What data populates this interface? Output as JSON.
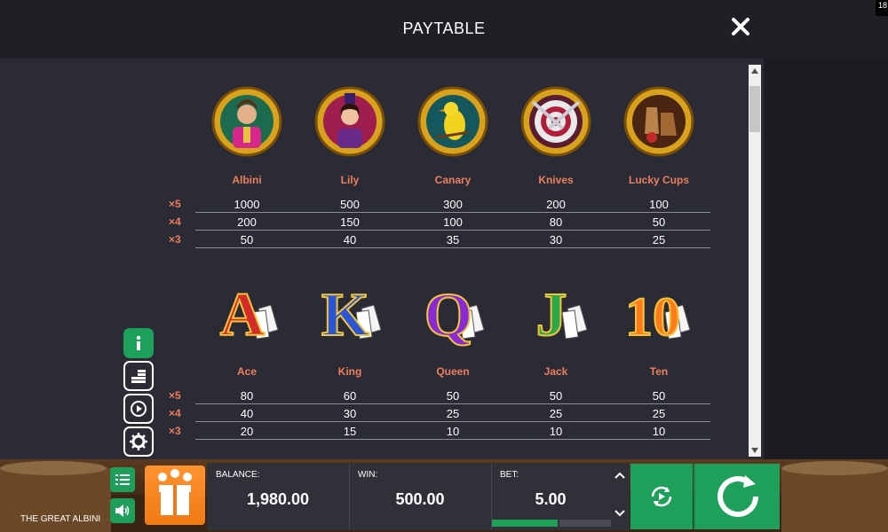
{
  "header": {
    "title": "PAYTABLE",
    "corner_badge": "18"
  },
  "symbols_top": {
    "names": [
      "Albini",
      "Lily",
      "Canary",
      "Knives",
      "Lucky Cups"
    ],
    "icons": [
      "magician-portrait-icon",
      "lady-portrait-icon",
      "canary-bird-icon",
      "knife-target-icon",
      "lucky-cups-icon"
    ],
    "rows": [
      {
        "mult": "×5",
        "values": [
          "1000",
          "500",
          "300",
          "200",
          "100"
        ]
      },
      {
        "mult": "×4",
        "values": [
          "200",
          "150",
          "100",
          "80",
          "50"
        ]
      },
      {
        "mult": "×3",
        "values": [
          "50",
          "40",
          "35",
          "30",
          "25"
        ]
      }
    ]
  },
  "symbols_bottom": {
    "names": [
      "Ace",
      "King",
      "Queen",
      "Jack",
      "Ten"
    ],
    "letters": [
      "A",
      "K",
      "Q",
      "J",
      "10"
    ],
    "letter_colors": [
      "#d42a2a",
      "#2a55d4",
      "#8a2ad4",
      "#2aa84a",
      "#ff7a1a"
    ],
    "rows": [
      {
        "mult": "×5",
        "values": [
          "80",
          "60",
          "50",
          "50",
          "50"
        ]
      },
      {
        "mult": "×4",
        "values": [
          "40",
          "30",
          "25",
          "25",
          "25"
        ]
      },
      {
        "mult": "×3",
        "values": [
          "20",
          "15",
          "10",
          "10",
          "10"
        ]
      }
    ]
  },
  "footer": {
    "game_name": "THE GREAT ALBINI",
    "balance_label": "BALANCE:",
    "balance_value": "1,980.00",
    "win_label": "WIN:",
    "win_value": "500.00",
    "bet_label": "BET:",
    "bet_value": "5.00"
  },
  "colors": {
    "accent_green": "#1ea05a",
    "label_orange": "#ee7e5c",
    "gift_orange": "#f07a14"
  }
}
